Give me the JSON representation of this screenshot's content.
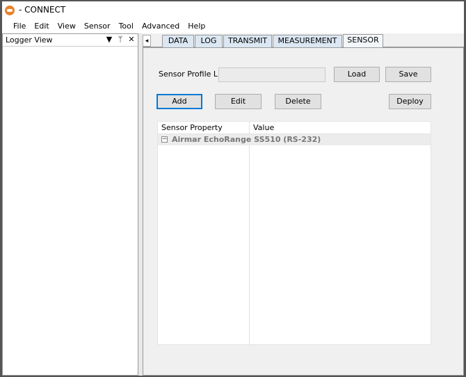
{
  "window": {
    "title": "- CONNECT"
  },
  "menu": [
    "File",
    "Edit",
    "View",
    "Sensor",
    "Tool",
    "Advanced",
    "Help"
  ],
  "logger": {
    "title": "Logger View",
    "dropdown_glyph": "▼",
    "pin_glyph": "ᛘ",
    "close_glyph": "✕"
  },
  "tabs": {
    "scroll_glyph": "◂",
    "items": [
      "DATA",
      "LOG",
      "TRANSMIT",
      "MEASUREMENT",
      "SENSOR"
    ],
    "active": "SENSOR"
  },
  "sensor": {
    "profile_list_label": "Sensor Profile List",
    "profile_list_value": "",
    "load_label": "Load",
    "save_label": "Save",
    "add_label": "Add",
    "edit_label": "Edit",
    "delete_label": "Delete",
    "deploy_label": "Deploy"
  },
  "grid": {
    "col_property": "Sensor Property",
    "col_value": "Value",
    "category": "Airmar EchoRange SS510 (RS-232)",
    "expander_glyph": "−"
  }
}
